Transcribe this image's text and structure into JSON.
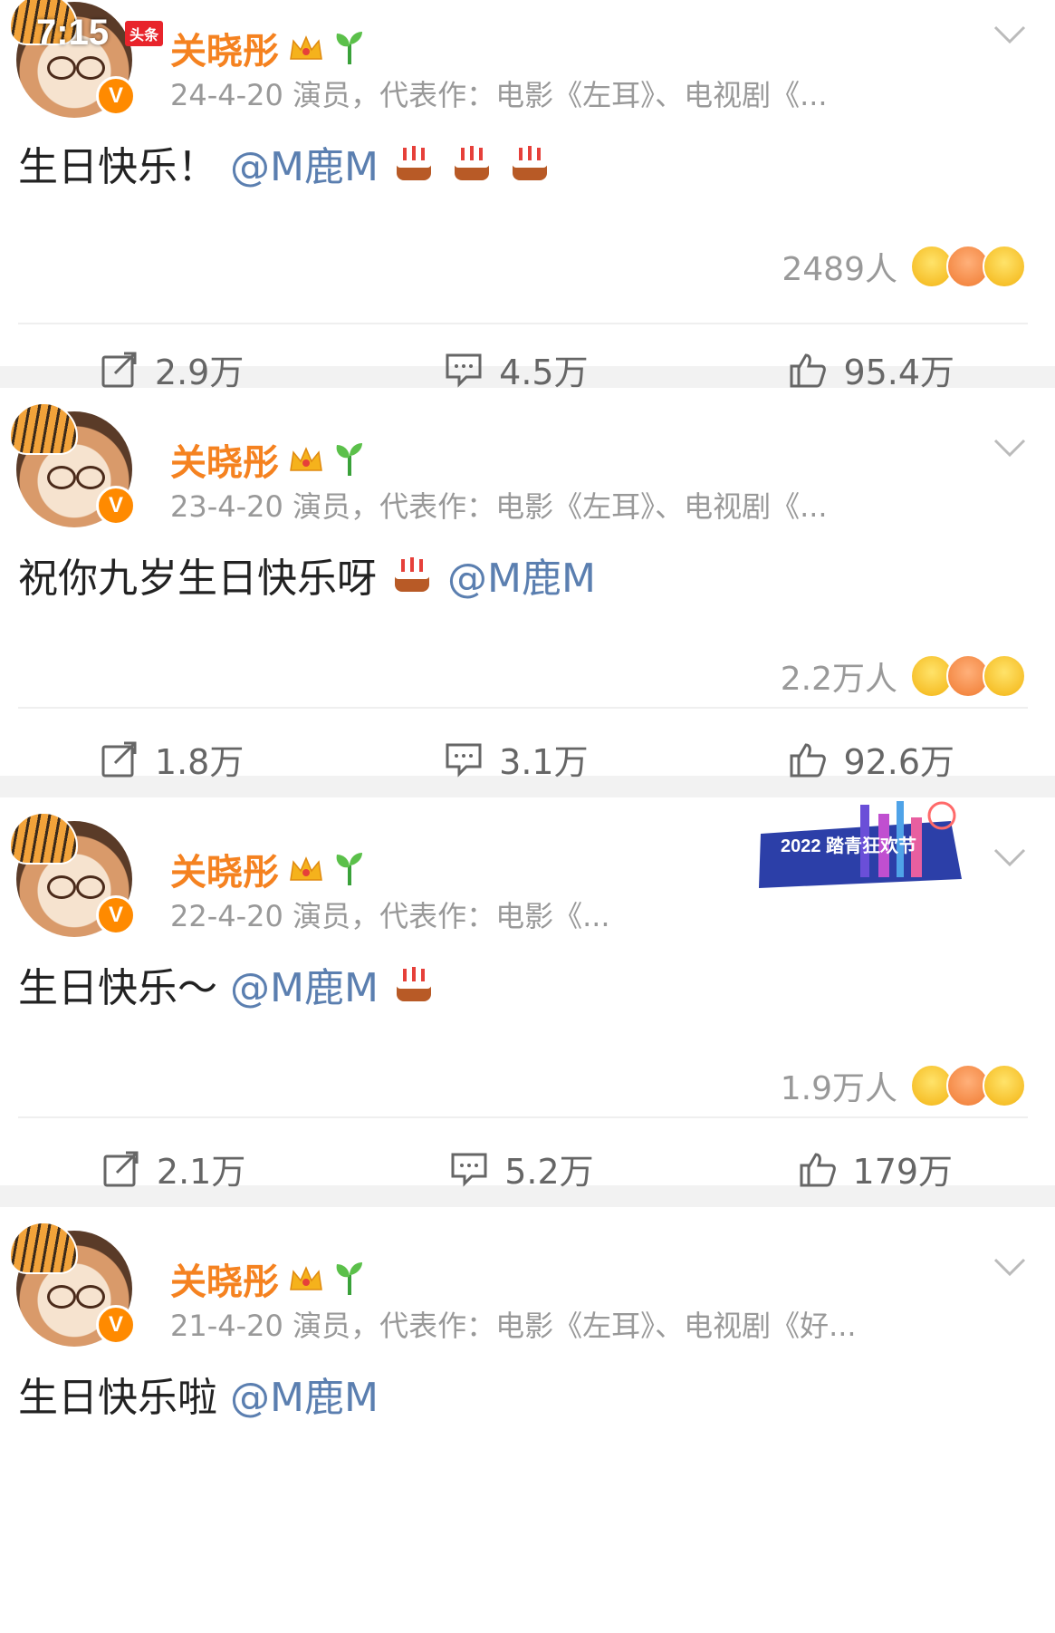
{
  "status": {
    "time": "7:15",
    "app_badge": "头条"
  },
  "posts": [
    {
      "username": "关晓彤",
      "meta": "24-4-20  演员，代表作：电影《左耳》、电视剧《...",
      "text": "生日快乐！",
      "mention": "@M鹿M",
      "cakes": 3,
      "reactions": "2489人",
      "share": "2.9万",
      "comment": "4.5万",
      "like": "95.4万"
    },
    {
      "username": "关晓彤",
      "meta": "23-4-20  演员，代表作：电影《左耳》、电视剧《...",
      "text": "祝你九岁生日快乐呀",
      "mention": "@M鹿M",
      "cakes": 1,
      "reactions": "2.2万人",
      "share": "1.8万",
      "comment": "3.1万",
      "like": "92.6万"
    },
    {
      "username": "关晓彤",
      "meta": "22-4-20  演员，代表作：电影《...",
      "text": "生日快乐～",
      "mention": "@M鹿M",
      "cakes": 1,
      "banner": "2022 踏青狂欢节",
      "reactions": "1.9万人",
      "share": "2.1万",
      "comment": "5.2万",
      "like": "179万"
    },
    {
      "username": "关晓彤",
      "meta": "21-4-20  演员，代表作：电影《左耳》、电视剧《好...",
      "text": "生日快乐啦",
      "mention": "@M鹿M"
    }
  ],
  "icons": {
    "share": "share-icon",
    "comment": "comment-icon",
    "like": "thumbs-up-icon",
    "expand": "chevron-down-icon",
    "cake": "birthday-cake-icon",
    "crown": "crown-icon",
    "sprout": "sprout-icon"
  },
  "colors": {
    "username": "#f58220",
    "mention": "#5b7fb0",
    "meta": "#999999",
    "verified": "#ff8a00"
  }
}
